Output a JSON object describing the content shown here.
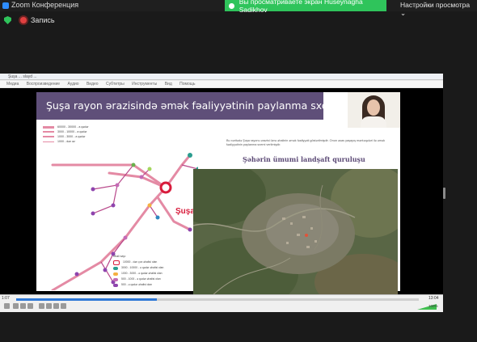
{
  "window": {
    "title": "Zoom Конференция"
  },
  "banner": {
    "sharing_text": "Вы просматриваете экран Huseynagha Sadikhov",
    "view_options": "Настройки просмотра ⌄"
  },
  "recording": {
    "label": "Запись"
  },
  "shared_app": {
    "title": "Şuşa ... slayd ...",
    "menu": [
      "Медиа",
      "Воспроизведение",
      "Аудио",
      "Видео",
      "Субтитры",
      "Инструменты",
      "Вид",
      "Помощь"
    ]
  },
  "slide": {
    "title": "Şuşa rayon ərazisində əmək fəaliyyətinin paylanma sxemi",
    "city_label": "Şuşa",
    "line_legend": [
      "60000 - 30000 - a qədər",
      "3000 - 10000 - a qədər",
      "1000 - 3000 - a qədər",
      "1000 - dən az"
    ],
    "point_legend_title": "Əhali sayı:",
    "point_legend": [
      "10000 - dən çox əhalisi olan",
      "3000 - 10000 - ə qədər əhalisi olan",
      "1000 - 3000 - ə qədər əhalisi olan",
      "500 - 1000 - ə qədər əhalisi olan",
      "500 - ə qədər əhalisi olan"
    ],
    "right_text": "Bu xəritədə Şuşa rayonu ərazisi üzrə əhalinin əmək fəaliyyəti göstərilmişdir. Onun əsas yaşayış məntəqələri ilə əmək fəaliyyətinin paylanma sxemi verilmişdir.",
    "subtitle": "Şəhərin ümumi landşaft quruluşu"
  },
  "player": {
    "time_elapsed": "1:07",
    "time_total": "13:04",
    "volume": "100%",
    "progress": 0.35
  },
  "colors": {
    "banner": "#2fc45b",
    "header": "#5f4f79",
    "route": "#e48aa4",
    "accent": "#d81b3b"
  }
}
